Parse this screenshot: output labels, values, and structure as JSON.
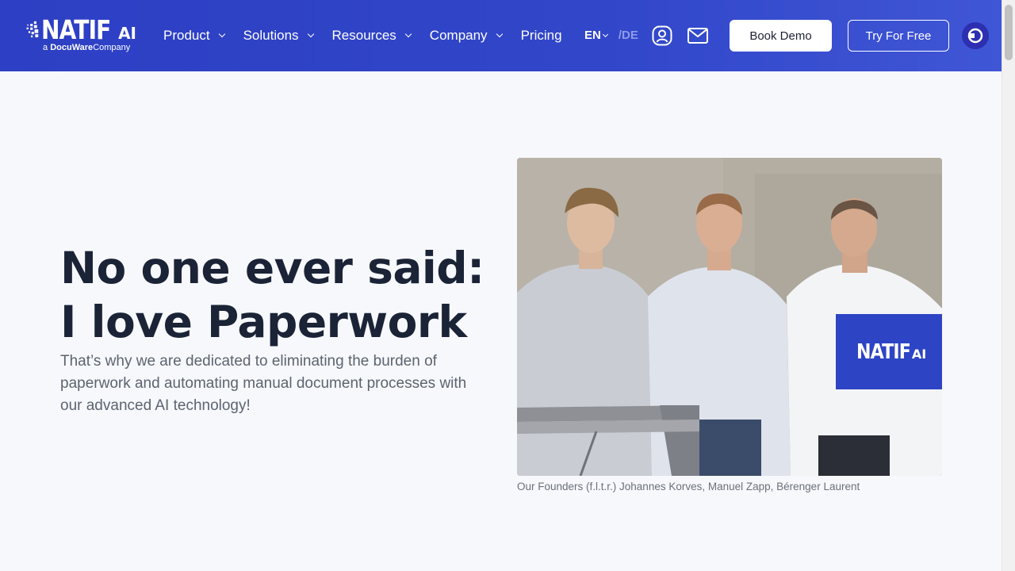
{
  "header": {
    "logo": {
      "main": "NATIF",
      "ai": "AI",
      "sub_prefix": "a",
      "sub_brand": "DocuWare",
      "sub_suffix": "Company"
    },
    "nav": [
      {
        "label": "Product"
      },
      {
        "label": "Solutions"
      },
      {
        "label": "Resources"
      },
      {
        "label": "Company"
      },
      {
        "label": "Pricing"
      }
    ],
    "lang": {
      "current": "EN",
      "separator": "/",
      "other": "DE"
    },
    "book_demo": "Book Demo",
    "try_free": "Try For Free",
    "colors": {
      "header_bg": "#3146c9",
      "accent": "#2d44c4"
    }
  },
  "hero": {
    "title_line1": "No one ever said:",
    "title_line2": "I love Paperwork",
    "text": "That’s why we are dedicated to eliminating the burden of paperwork and automating manual document processes with our advanced AI technology!",
    "photo_logo": {
      "main": "NATIF",
      "ai": "AI"
    },
    "caption": "Our Founders (f.l.t.r.) Johannes Korves, Manuel Zapp, Bérenger Laurent"
  }
}
